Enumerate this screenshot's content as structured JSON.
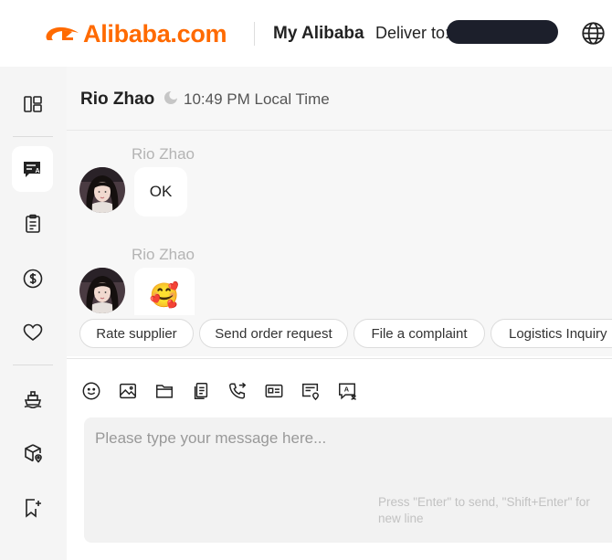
{
  "header": {
    "logo_text": "Alibaba.com",
    "my_alibaba": "My Alibaba",
    "deliver_label": "Deliver to:",
    "brand_color": "#ff6a00"
  },
  "rail": {
    "items": [
      {
        "icon": "dashboard-icon"
      },
      {
        "icon": "chat-ai-icon",
        "active": true
      },
      {
        "icon": "clipboard-icon"
      },
      {
        "icon": "dollar-icon"
      },
      {
        "icon": "heart-icon"
      },
      {
        "icon": "ship-icon"
      },
      {
        "icon": "package-location-icon"
      },
      {
        "icon": "bookmark-add-icon"
      }
    ]
  },
  "chat": {
    "contact_name": "Rio Zhao",
    "local_time": "10:49 PM Local Time",
    "messages": [
      {
        "sender": "Rio Zhao",
        "text": "OK"
      },
      {
        "sender": "Rio Zhao",
        "text": "🥰"
      }
    ]
  },
  "quick_actions": [
    "Rate supplier",
    "Send order request",
    "File a complaint",
    "Logistics Inquiry"
  ],
  "composer": {
    "placeholder": "Please type your message here...",
    "hint": "Press \"Enter\" to send, \"Shift+Enter\" for new line",
    "tools": [
      "emoji-icon",
      "image-icon",
      "folder-icon",
      "document-icon",
      "phone-icon",
      "card-icon",
      "quote-icon",
      "translate-icon"
    ]
  }
}
